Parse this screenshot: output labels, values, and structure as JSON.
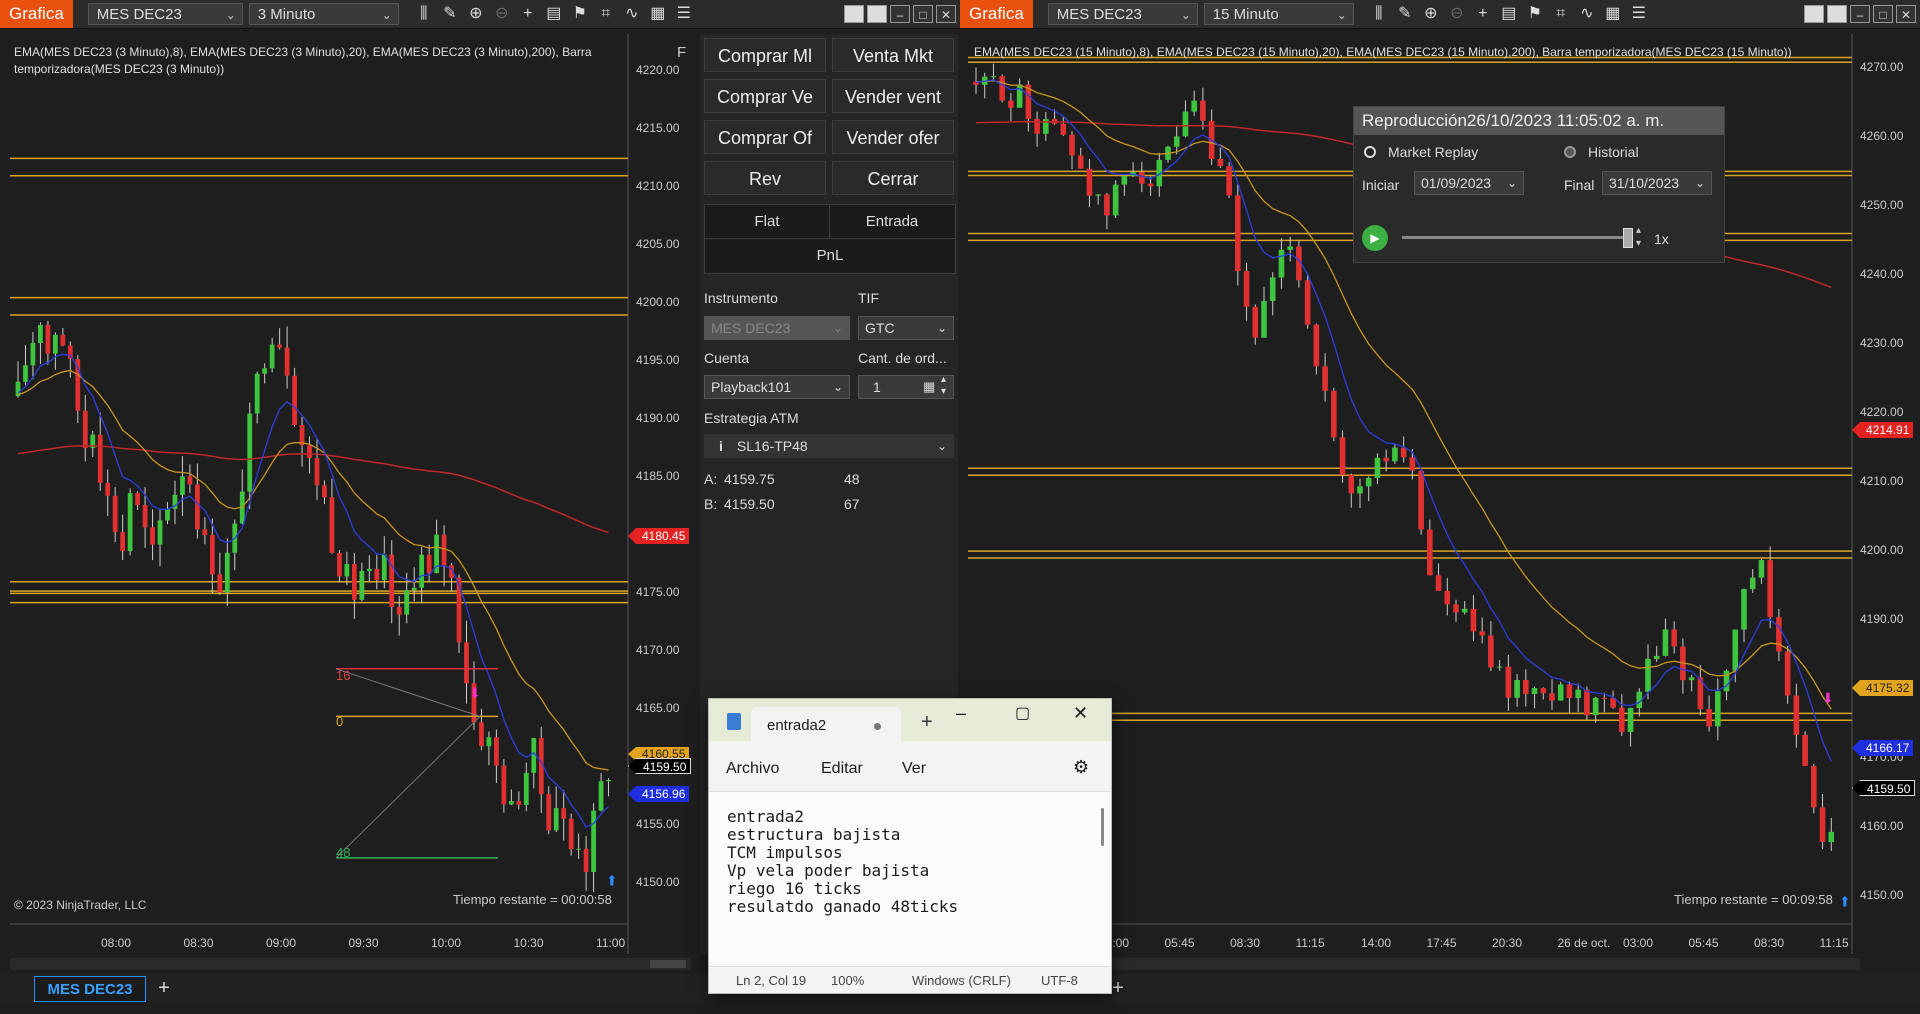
{
  "left_window": {
    "title_button": "Grafica",
    "instrument": "MES DEC23",
    "interval": "3 Minuto",
    "legend": "EMA(MES DEC23 (3 Minuto),8), EMA(MES DEC23 (3 Minuto),20), EMA(MES DEC23 (3 Minuto),200), Barra temporizadora(MES DEC23 (3 Minuto))",
    "collapse_label": "F",
    "y_ticks": [
      "4220.00",
      "4215.00",
      "4210.00",
      "4205.00",
      "4200.00",
      "4195.00",
      "4190.00",
      "4185.00",
      "4180.00",
      "4175.00",
      "4170.00",
      "4165.00",
      "4160.00",
      "4155.00",
      "4150.00"
    ],
    "x_ticks": [
      "08:00",
      "08:30",
      "09:00",
      "09:30",
      "10:00",
      "10:30",
      "11:00"
    ],
    "price_tags": {
      "red": "4180.45",
      "last": "4159.50",
      "blue": "4156.96",
      "yellow": "4160.55"
    },
    "annotations": {
      "stop": "16",
      "entry": "0",
      "target": "48"
    },
    "copyright": "© 2023 NinjaTrader, LLC",
    "timer": "Tiempo restante = 00:00:58",
    "tab_label": "MES DEC23",
    "add_tab": "+"
  },
  "order_panel": {
    "buttons": [
      {
        "label": "Comprar Ml"
      },
      {
        "label": "Venta Mkt"
      },
      {
        "label": "Comprar Ve"
      },
      {
        "label": "Vender vent"
      },
      {
        "label": "Comprar Of"
      },
      {
        "label": "Vender ofer"
      },
      {
        "label": "Rev"
      },
      {
        "label": "Cerrar"
      }
    ],
    "position": {
      "flat": "Flat",
      "entry": "Entrada",
      "pnl": "PnL"
    },
    "instrument_label": "Instrumento",
    "instrument_value": "MES DEC23",
    "tif_label": "TIF",
    "tif_value": "GTC",
    "account_label": "Cuenta",
    "account_value": "Playback101",
    "qty_label": "Cant. de ord...",
    "qty_value": "1",
    "atm_label": "Estrategia ATM",
    "atm_value": "SL16-TP48",
    "ask_label": "A:",
    "ask_price": "4159.75",
    "ask_size": "48",
    "bid_label": "B:",
    "bid_price": "4159.50",
    "bid_size": "67"
  },
  "right_window": {
    "title_button": "Grafica",
    "instrument": "MES DEC23",
    "interval": "15 Minuto",
    "legend": "EMA(MES DEC23 (15 Minuto),8), EMA(MES DEC23 (15 Minuto),20), EMA(MES DEC23 (15 Minuto),200), Barra temporizadora(MES DEC23 (15 Minuto))",
    "y_ticks": [
      "4270.00",
      "4260.00",
      "4250.00",
      "4240.00",
      "4230.00",
      "4220.00",
      "4210.00",
      "4200.00",
      "4190.00",
      "4180.00",
      "4170.00",
      "4160.00",
      "4150.00"
    ],
    "x_ticks": [
      "03:00",
      "05:45",
      "08:30",
      "11:15",
      "14:00",
      "17:45",
      "20:30",
      "26 de oct.",
      "03:00",
      "05:45",
      "08:30",
      "11:15"
    ],
    "price_tags": {
      "red": "4214.91",
      "yellow": "4175.32",
      "blue": "4166.17",
      "last": "4159.50"
    },
    "timer": "Tiempo restante = 00:09:58",
    "add_tab": "+"
  },
  "replay": {
    "title": "Reproducción26/10/2023 11:05:02 a. m.",
    "option_market": "Market Replay",
    "option_history": "Historial",
    "start_label": "Iniciar",
    "start_value": "01/09/2023",
    "end_label": "Final",
    "end_value": "31/10/2023",
    "speed": "1x",
    "slider_progress": 0.98
  },
  "notepad": {
    "tab_title": "entrada2",
    "menu": [
      "Archivo",
      "Editar",
      "Ver"
    ],
    "lines": [
      "entrada2",
      "estructura bajista",
      "TCM impulsos",
      "Vp vela poder bajista",
      "riego 16 ticks",
      "resulatdo ganado 48ticks"
    ],
    "status": {
      "position": "Ln 2, Col 19",
      "zoom": "100%",
      "eol": "Windows (CRLF)",
      "encoding": "UTF-8"
    },
    "add_tab": "+"
  },
  "colors": {
    "accent": "#e8500e",
    "level_line": "#d9a520",
    "ema200": "#c0282a",
    "ema8": "#2b3fe0",
    "ema20": "#c8961e",
    "bull": "#3fc43f",
    "bear": "#e03030"
  }
}
